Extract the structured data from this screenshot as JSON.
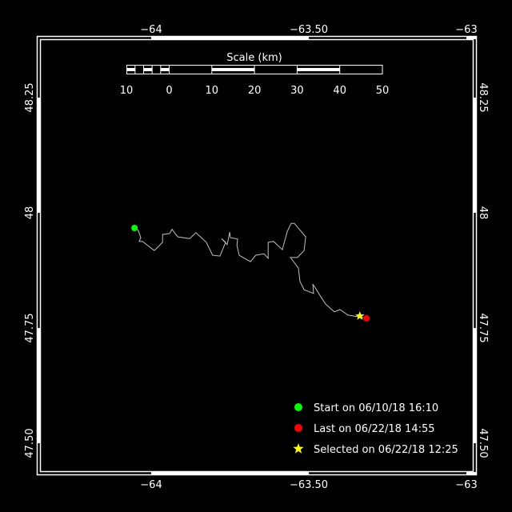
{
  "map": {
    "lon_ticks": [
      {
        "value": -64,
        "label": "−64"
      },
      {
        "value": -63.5,
        "label": "−63.50"
      },
      {
        "value": -63,
        "label": "−63"
      }
    ],
    "lat_ticks": [
      {
        "value": 48.25,
        "label": "48.25"
      },
      {
        "value": 48,
        "label": "48"
      },
      {
        "value": 47.75,
        "label": "47.75"
      },
      {
        "value": 47.5,
        "label": "47.50"
      }
    ],
    "track_color": "#c0c0c0",
    "track": [
      [
        -64.053,
        47.967
      ],
      [
        -64.041,
        47.962
      ],
      [
        -64.033,
        47.946
      ],
      [
        -64.038,
        47.938
      ],
      [
        -64.028,
        47.938
      ],
      [
        -63.99,
        47.918
      ],
      [
        -63.964,
        47.936
      ],
      [
        -63.964,
        47.953
      ],
      [
        -63.942,
        47.955
      ],
      [
        -63.934,
        47.964
      ],
      [
        -63.916,
        47.948
      ],
      [
        -63.878,
        47.944
      ],
      [
        -63.858,
        47.957
      ],
      [
        -63.825,
        47.936
      ],
      [
        -63.805,
        47.908
      ],
      [
        -63.782,
        47.906
      ],
      [
        -63.764,
        47.936
      ],
      [
        -63.777,
        47.944
      ],
      [
        -63.759,
        47.931
      ],
      [
        -63.751,
        47.958
      ],
      [
        -63.749,
        47.946
      ],
      [
        -63.726,
        47.943
      ],
      [
        -63.728,
        47.929
      ],
      [
        -63.721,
        47.908
      ],
      [
        -63.685,
        47.894
      ],
      [
        -63.668,
        47.908
      ],
      [
        -63.642,
        47.911
      ],
      [
        -63.629,
        47.901
      ],
      [
        -63.629,
        47.936
      ],
      [
        -63.612,
        47.938
      ],
      [
        -63.584,
        47.92
      ],
      [
        -63.569,
        47.958
      ],
      [
        -63.556,
        47.977
      ],
      [
        -63.546,
        47.977
      ],
      [
        -63.51,
        47.948
      ],
      [
        -63.515,
        47.918
      ],
      [
        -63.536,
        47.903
      ],
      [
        -63.558,
        47.903
      ],
      [
        -63.533,
        47.88
      ],
      [
        -63.528,
        47.851
      ],
      [
        -63.515,
        47.833
      ],
      [
        -63.485,
        47.825
      ],
      [
        -63.487,
        47.845
      ],
      [
        -63.447,
        47.802
      ],
      [
        -63.419,
        47.785
      ],
      [
        -63.401,
        47.79
      ],
      [
        -63.376,
        47.778
      ],
      [
        -63.338,
        47.774
      ],
      [
        -63.317,
        47.771
      ]
    ],
    "start": {
      "lon": -64.053,
      "lat": 47.967,
      "color": "#00ff00"
    },
    "last": {
      "lon": -63.317,
      "lat": 47.771,
      "color": "#ff0000"
    },
    "selected": {
      "lon": -63.338,
      "lat": 47.776,
      "color": "#ffff00"
    }
  },
  "scale": {
    "title": "Scale (km)",
    "labels": [
      "10",
      "0",
      "10",
      "20",
      "30",
      "40",
      "50"
    ]
  },
  "legend": {
    "start": "Start on 06/10/18 16:10",
    "last": "Last on 06/22/18 14:55",
    "selected": "Selected on 06/22/18 12:25"
  }
}
